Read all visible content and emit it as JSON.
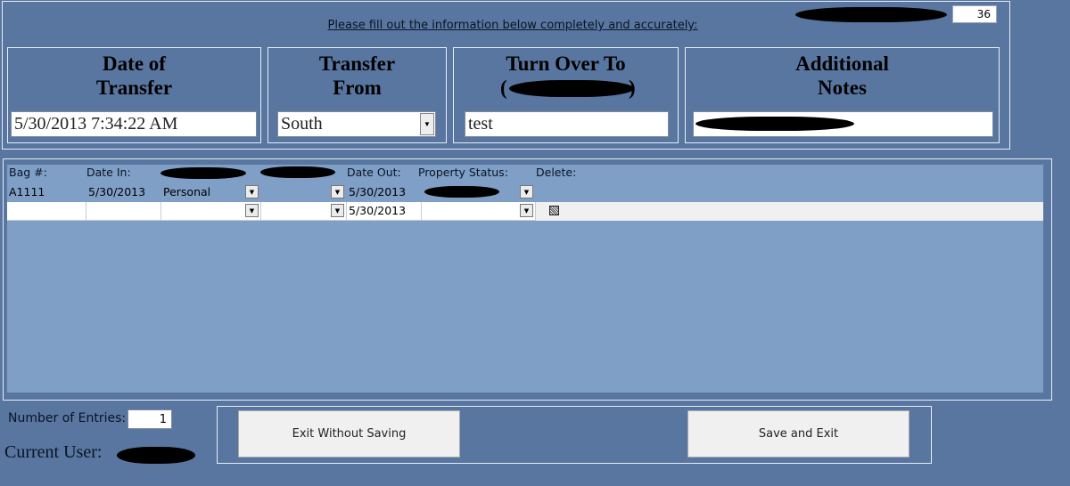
{
  "header": {
    "instructions": "Please fill out the information below completely and accurately:",
    "record_number": "36"
  },
  "sections": {
    "date_of_transfer": {
      "title_line1": "Date of",
      "title_line2": "Transfer",
      "value": "5/30/2013 7:34:22 AM"
    },
    "transfer_from": {
      "title_line1": "Transfer",
      "title_line2": "From",
      "value": "South"
    },
    "turn_over_to": {
      "title_line1": "Turn Over To",
      "title_line2_prefix": "(",
      "title_line2_suffix": ")",
      "value": "test"
    },
    "additional_notes": {
      "title_line1": "Additional",
      "title_line2": "Notes"
    }
  },
  "table": {
    "headers": {
      "bag": "Bag #:",
      "date_in": "Date In:",
      "date_out": "Date Out:",
      "property_status": "Property Status:",
      "delete": "Delete:"
    },
    "rows": [
      {
        "bag": "A1111",
        "date_in": "5/30/2013",
        "type": "Personal",
        "date_out": "5/30/2013",
        "delete_checked": false
      },
      {
        "bag": "",
        "date_in": "",
        "type": "",
        "date_out": "5/30/2013",
        "delete_checked": true
      }
    ]
  },
  "footer": {
    "entries_label": "Number of Entries:",
    "entries_value": "1",
    "user_label": "Current User:",
    "exit_button": "Exit Without Saving",
    "save_button": "Save and Exit"
  },
  "colors": {
    "background": "#5876a0",
    "table_background": "#7f9fc6",
    "selected_row": "#f0f0f0"
  }
}
